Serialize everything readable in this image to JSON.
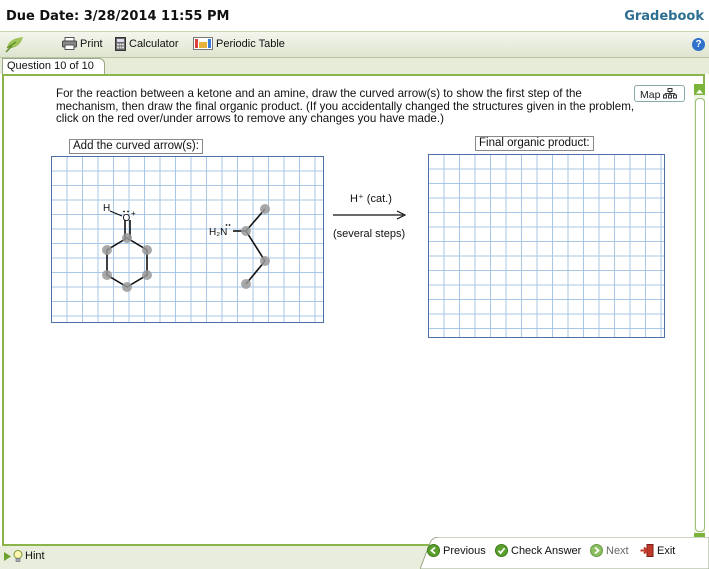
{
  "header": {
    "due_date": "Due Date: 3/28/2014 11:55 PM",
    "gradebook": "Gradebook"
  },
  "toolbar": {
    "print": "Print",
    "calculator": "Calculator",
    "periodic_table": "Periodic Table",
    "help": "?"
  },
  "question_tab": "Question 10 of 10",
  "question_text": "For the reaction between a ketone and an amine, draw the curved arrow(s) to show the first step of the mechanism, then draw the final organic product. (If you accidentally changed the structures given in the problem, click on the red over/under arrows to remove any changes you have made.)",
  "map_button": "Map",
  "left_panel": {
    "label": "Add the curved arrow(s):",
    "h_atom": "H",
    "o_atom": "O",
    "o_charge": "+",
    "amine": "H₂N"
  },
  "reaction": {
    "above": "H⁺ (cat.)",
    "below": "(several steps)"
  },
  "right_panel": {
    "label": "Final organic product:"
  },
  "footer": {
    "hint": "Hint",
    "previous": "Previous",
    "check_answer": "Check Answer",
    "next": "Next",
    "exit": "Exit"
  },
  "colors": {
    "accent_green": "#8bb54a",
    "gradebook_blue": "#2d6f91",
    "grid_line": "#a8c7e6"
  }
}
